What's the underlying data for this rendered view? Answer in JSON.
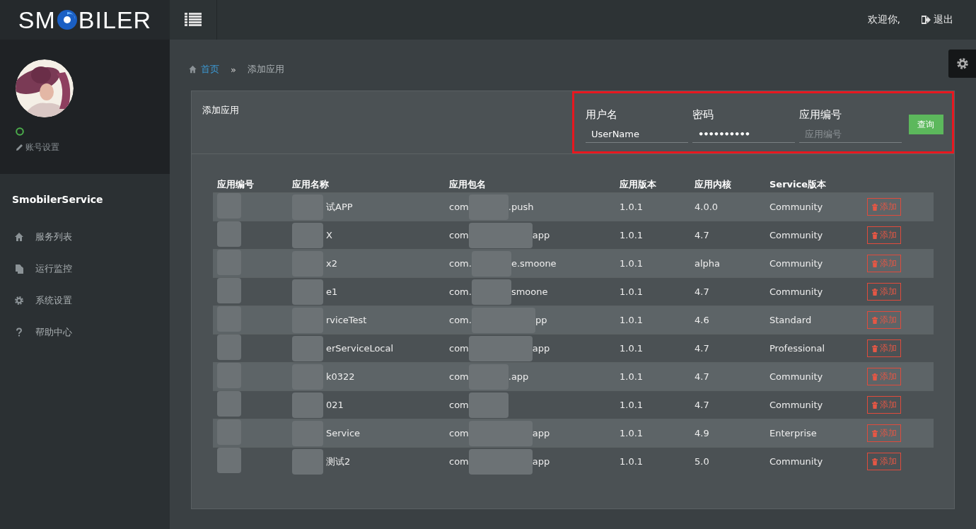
{
  "header": {
    "logo": [
      "SM",
      "BILER"
    ],
    "welcome": "欢迎你,",
    "logout": "退出"
  },
  "sidebar": {
    "online": true,
    "account_settings": "账号设置",
    "service_name": "SmobilerService",
    "items": [
      {
        "label": "服务列表"
      },
      {
        "label": "运行监控"
      },
      {
        "label": "系统设置"
      },
      {
        "label": "帮助中心"
      }
    ]
  },
  "breadcrumb": {
    "home": "首页",
    "separator": "»",
    "current": "添加应用"
  },
  "panel": {
    "title": "添加应用",
    "form": {
      "fields": [
        {
          "label": "用户名",
          "value": "UserName",
          "kind": "text"
        },
        {
          "label": "密码",
          "value": "••••••••••",
          "kind": "password"
        },
        {
          "label": "应用编号",
          "placeholder": "应用编号",
          "kind": "text"
        }
      ],
      "button": "查询"
    },
    "table": {
      "columns": [
        "应用编号",
        "应用名称",
        "应用包名",
        "应用版本",
        "应用内核",
        "Service版本"
      ],
      "rows": [
        {
          "name": "试APP",
          "package": [
            "com",
            ".push"
          ],
          "version": "1.0.1",
          "core": "4.0.0",
          "service": "Community",
          "action": "添加"
        },
        {
          "name": "X",
          "package": [
            "com",
            "app"
          ],
          "version": "1.0.1",
          "core": "4.7",
          "service": "Community",
          "action": "添加"
        },
        {
          "name": "x2",
          "package": [
            "com.",
            "e.smoone"
          ],
          "version": "1.0.1",
          "core": "alpha",
          "service": "Community",
          "action": "添加"
        },
        {
          "name": "e1",
          "package": [
            "com.",
            "smoone"
          ],
          "version": "1.0.1",
          "core": "4.7",
          "service": "Community",
          "action": "添加"
        },
        {
          "name": "rviceTest",
          "package": [
            "com.",
            "pp"
          ],
          "version": "1.0.1",
          "core": "4.6",
          "service": "Standard",
          "action": "添加"
        },
        {
          "name": "erServiceLocal",
          "package": [
            "com",
            "app"
          ],
          "version": "1.0.1",
          "core": "4.7",
          "service": "Professional",
          "action": "添加"
        },
        {
          "name": "k0322",
          "package": [
            "com",
            ".app"
          ],
          "version": "1.0.1",
          "core": "4.7",
          "service": "Community",
          "action": "添加"
        },
        {
          "name": "021",
          "package": [
            "com"
          ],
          "version": "1.0.1",
          "core": "4.7",
          "service": "Community",
          "action": "添加"
        },
        {
          "name": "Service",
          "package": [
            "com",
            "app"
          ],
          "version": "1.0.1",
          "core": "4.9",
          "service": "Enterprise",
          "action": "添加"
        },
        {
          "name": "测试2",
          "package": [
            "com",
            "app"
          ],
          "version": "1.0.1",
          "core": "5.0",
          "service": "Community",
          "action": "添加"
        }
      ]
    }
  }
}
